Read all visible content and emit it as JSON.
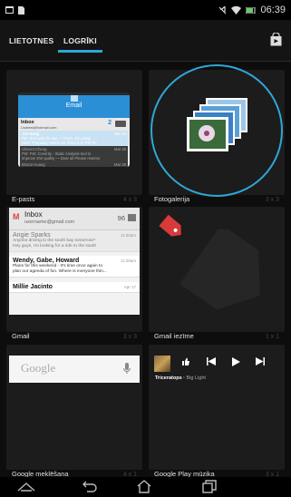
{
  "status": {
    "time": "06:39"
  },
  "tabs": [
    {
      "label": "LIETOTNES"
    },
    {
      "label": "LOGRĪKI"
    }
  ],
  "widgets": [
    {
      "label": "E-pasts",
      "size": "4 x 3"
    },
    {
      "label": "Fotogalerija",
      "size": "3 x 3"
    },
    {
      "label": "Gmail",
      "size": "3 x 3"
    },
    {
      "label": "Gmail iezīme",
      "size": "1 x 1"
    },
    {
      "label": "Google meklēšana",
      "size": "4 x 1"
    },
    {
      "label": "Google Play mūzika",
      "size": "3 x 1"
    }
  ],
  "email_preview": {
    "header": "Email",
    "inbox": "Inbox",
    "account": "Lisatest@hotmail.com",
    "count": "2",
    "items": [
      {
        "from": "Jim Hong",
        "date": "Mar 28",
        "line1": "RE: Test case for sso — From: Jim Hong",
        "line2": "Sent: Thursday, March 28, 2013 3:17 PM To:"
      },
      {
        "from": "Vincent Cheng",
        "date": "Mar 28",
        "line1": "FW: FW: Coverity - Static Analysis tool to",
        "line2": "Improve SW quality — Dear all Please reserve"
      },
      {
        "from": "Brian2 Huang",
        "date": "Mar 28",
        "line1": "",
        "line2": ""
      }
    ]
  },
  "gmail_preview": {
    "inbox": "Inbox",
    "account": "username@gmail.com",
    "count": "96",
    "rows": [
      {
        "from": "Angie Sparks",
        "time": "11:50am",
        "sub1": "Anyone driving to the south bay tomorrow?",
        "sub2": "Hey guys, I'm looking for a ride to the south"
      },
      {
        "from": "Wendy, Gabe, Howard",
        "time": "11:29am",
        "sub1": "Plans for this weekend - It's time once again to",
        "sub2": "plan our agenda of fun. Where is everyone thin..."
      },
      {
        "from": "Millie Jacinto",
        "time": "Apr 17",
        "sub1": "",
        "sub2": ""
      }
    ]
  },
  "search_preview": {
    "logo": "Google"
  },
  "music_preview": {
    "artist": "Triceratops",
    "song": "Big Light"
  },
  "colors": {
    "accent": "#2fa7d6",
    "background": "#0d0d0d"
  }
}
